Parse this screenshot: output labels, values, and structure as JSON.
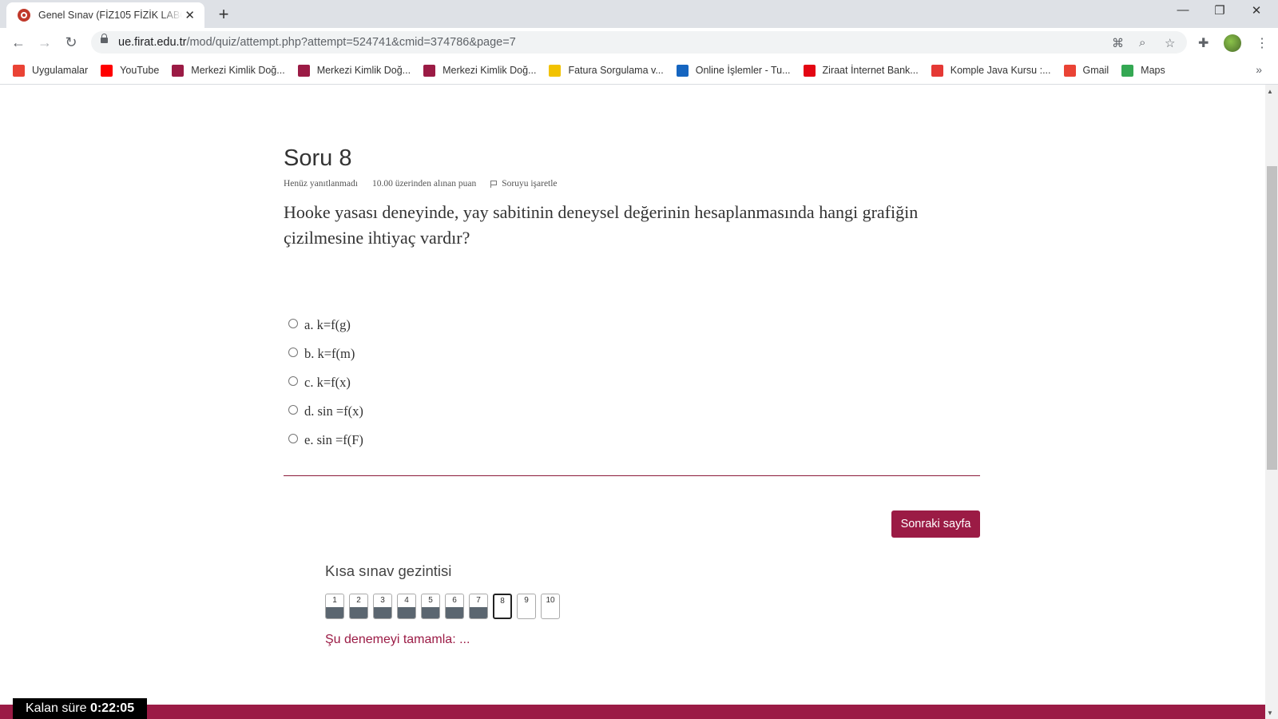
{
  "browser": {
    "tab_title": "Genel Sınav (FİZ105 FİZİK LABORATUVARI",
    "url_host": "ue.firat.edu.tr",
    "url_path": "/mod/quiz/attempt.php?attempt=524741&cmid=374786&page=7",
    "bookmarks": [
      {
        "label": "Uygulamalar",
        "icon": "apps-grid-icon",
        "color": "#ea4335"
      },
      {
        "label": "YouTube",
        "icon": "youtube-icon",
        "color": "#ff0000"
      },
      {
        "label": "Merkezi Kimlik Doğ...",
        "icon": "kimlik-icon",
        "color": "#9b1b45"
      },
      {
        "label": "Merkezi Kimlik Doğ...",
        "icon": "kimlik-icon",
        "color": "#9b1b45"
      },
      {
        "label": "Merkezi Kimlik Doğ...",
        "icon": "kimlik-icon",
        "color": "#9b1b45"
      },
      {
        "label": "Fatura Sorgulama v...",
        "icon": "fatura-icon",
        "color": "#f2c200"
      },
      {
        "label": "Online İşlemler - Tu...",
        "icon": "online-icon",
        "color": "#1565c0"
      },
      {
        "label": "Ziraat İnternet Bank...",
        "icon": "ziraat-icon",
        "color": "#e30613"
      },
      {
        "label": "Komple Java Kursu :...",
        "icon": "udemy-icon",
        "color": "#e53935"
      },
      {
        "label": "Gmail",
        "icon": "gmail-icon",
        "color": "#ea4335"
      },
      {
        "label": "Maps",
        "icon": "maps-icon",
        "color": "#34a853"
      }
    ]
  },
  "question": {
    "title": "Soru 8",
    "status": "Henüz yanıtlanmadı",
    "points": "10.00 üzerinden alınan puan",
    "flag_label": "Soruyu işaretle",
    "text": "Hooke yasası deneyinde, yay sabitinin deneysel değerinin hesaplanmasında hangi grafiğin çizilmesine ihtiyaç vardır?",
    "answers": [
      "a. k=f(g)",
      "b. k=f(m)",
      "c. k=f(x)",
      "d. sin =f(x)",
      "e. sin =f(F)"
    ]
  },
  "next_button": "Sonraki sayfa",
  "navigation": {
    "title": "Kısa sınav gezintisi",
    "boxes": [
      {
        "num": "1",
        "state": "answered"
      },
      {
        "num": "2",
        "state": "answered"
      },
      {
        "num": "3",
        "state": "answered"
      },
      {
        "num": "4",
        "state": "answered"
      },
      {
        "num": "5",
        "state": "answered"
      },
      {
        "num": "6",
        "state": "answered"
      },
      {
        "num": "7",
        "state": "answered"
      },
      {
        "num": "8",
        "state": "current"
      },
      {
        "num": "9",
        "state": "unanswered"
      },
      {
        "num": "10",
        "state": "unanswered"
      }
    ],
    "finish_link": "Şu denemeyi tamamla: ..."
  },
  "timer": {
    "label": "Kalan süre",
    "value": "0:22:05"
  },
  "colors": {
    "accent": "#9b1b45"
  }
}
